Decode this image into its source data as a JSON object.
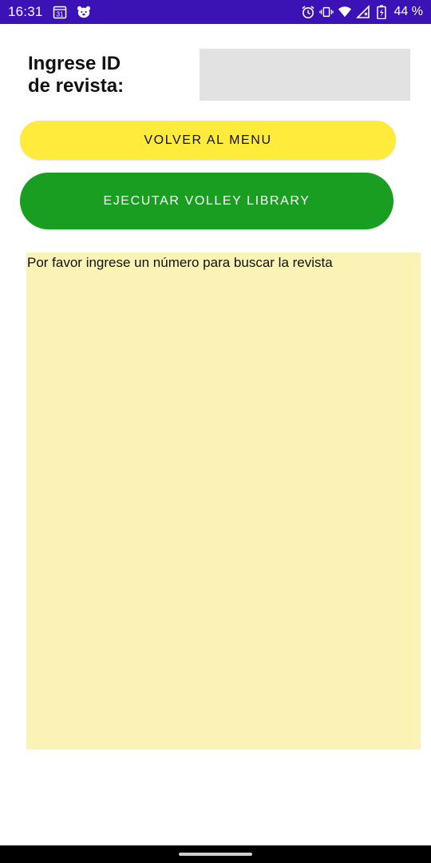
{
  "status_bar": {
    "time": "16:31",
    "calendar_day": "31",
    "battery_percent": "44 %",
    "background": "#3a12b6",
    "icons": [
      "calendar-icon",
      "bear-notification-icon",
      "alarm-icon",
      "vibrate-icon",
      "wifi-icon",
      "signal-icon",
      "battery-charging-icon"
    ]
  },
  "form": {
    "id_label": "Ingrese ID\nde revista:",
    "id_input_value": "",
    "id_input_placeholder": ""
  },
  "buttons": {
    "menu_label": "VOLVER AL MENU",
    "menu_color": "#ffeb3b",
    "volley_label": "EJECUTAR VOLLEY LIBRARY",
    "volley_color": "#1a9e22"
  },
  "result": {
    "text": "Por favor ingrese un número para buscar la revista",
    "background": "#fbf3b6"
  }
}
